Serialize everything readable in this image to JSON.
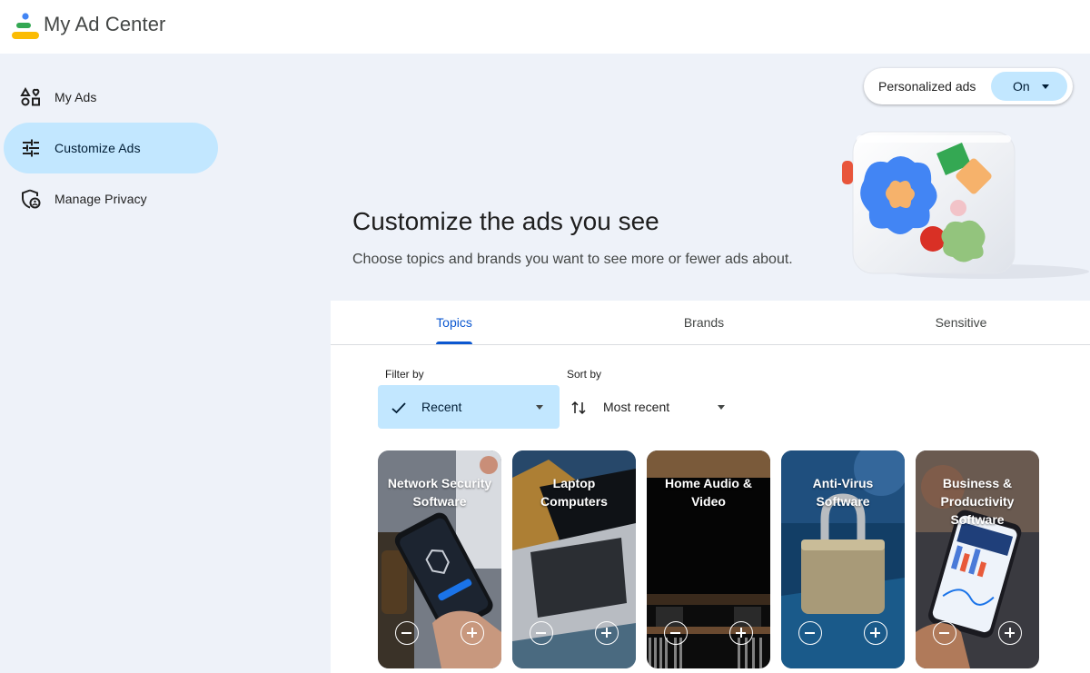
{
  "header": {
    "app_title": "My Ad Center",
    "logo_icon": "my-ad-center-logo"
  },
  "sidebar": {
    "items": [
      {
        "label": "My Ads",
        "icon": "shapes-icon",
        "active": false
      },
      {
        "label": "Customize Ads",
        "icon": "tune-icon",
        "active": true
      },
      {
        "label": "Manage Privacy",
        "icon": "shield-person-icon",
        "active": false
      }
    ]
  },
  "hero": {
    "personalized_label": "Personalized ads",
    "personalized_value": "On",
    "title": "Customize the ads you see",
    "subtitle": "Choose topics and brands you want to see more or fewer ads about."
  },
  "tabs": [
    {
      "label": "Topics",
      "active": true
    },
    {
      "label": "Brands",
      "active": false
    },
    {
      "label": "Sensitive",
      "active": false
    }
  ],
  "filters": {
    "filter_label": "Filter by",
    "filter_value": "Recent",
    "sort_label": "Sort by",
    "sort_value": "Most recent"
  },
  "cards": [
    {
      "title": "Network Security Software"
    },
    {
      "title": "Laptop Computers"
    },
    {
      "title": "Home Audio & Video"
    },
    {
      "title": "Anti-Virus Software"
    },
    {
      "title": "Business & Productivity Software"
    }
  ],
  "colors": {
    "accent": "#0b57d0",
    "selected_bg": "#c2e7ff",
    "sidebar_bg": "#eef2f9"
  }
}
